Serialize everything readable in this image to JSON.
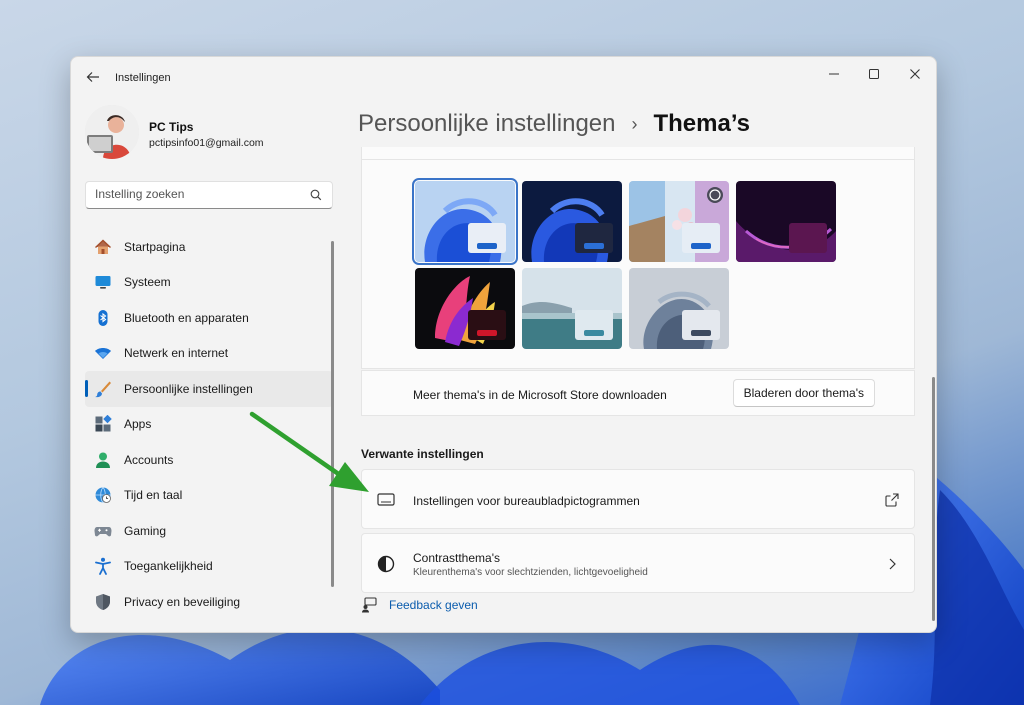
{
  "window": {
    "app_title": "Instellingen",
    "back_icon": "arrow-left-icon",
    "controls": [
      "minimize-icon",
      "maximize-icon",
      "close-icon"
    ]
  },
  "profile": {
    "name": "PC Tips",
    "email": "pctipsinfo01@gmail.com"
  },
  "search": {
    "placeholder": "Instelling zoeken",
    "icon": "search-icon"
  },
  "sidebar": {
    "items": [
      {
        "label": "Startpagina",
        "icon": "home-icon",
        "active": false
      },
      {
        "label": "Systeem",
        "icon": "monitor-icon",
        "active": false
      },
      {
        "label": "Bluetooth en apparaten",
        "icon": "bluetooth-icon",
        "active": false
      },
      {
        "label": "Netwerk en internet",
        "icon": "wifi-icon",
        "active": false
      },
      {
        "label": "Persoonlijke instellingen",
        "icon": "paintbrush-icon",
        "active": true
      },
      {
        "label": "Apps",
        "icon": "apps-icon",
        "active": false
      },
      {
        "label": "Accounts",
        "icon": "person-icon",
        "active": false
      },
      {
        "label": "Tijd en taal",
        "icon": "globe-clock-icon",
        "active": false
      },
      {
        "label": "Gaming",
        "icon": "gamepad-icon",
        "active": false
      },
      {
        "label": "Toegankelijkheid",
        "icon": "accessibility-icon",
        "active": false
      },
      {
        "label": "Privacy en beveiliging",
        "icon": "shield-icon",
        "active": false
      }
    ]
  },
  "header": {
    "parent": "Persoonlijke instellingen",
    "separator": "›",
    "current": "Thema’s"
  },
  "themes": {
    "items": [
      {
        "name": "windows-light",
        "selected": true
      },
      {
        "name": "windows-dark",
        "selected": false
      },
      {
        "name": "spotlight",
        "selected": false
      },
      {
        "name": "glow",
        "selected": false
      },
      {
        "name": "captured-motion",
        "selected": false
      },
      {
        "name": "sunrise",
        "selected": false
      },
      {
        "name": "flow",
        "selected": false
      }
    ],
    "store_text": "Meer thema's in de Microsoft Store downloaden",
    "browse_label": "Bladeren door thema's"
  },
  "related": {
    "title": "Verwante instellingen",
    "items": [
      {
        "title": "Instellingen voor bureaubladpictogrammen",
        "subtitle": "",
        "icon": "desktop-icon",
        "trail_icon": "open-external-icon"
      },
      {
        "title": "Contrastthema's",
        "subtitle": "Kleurenthema's voor slechtzienden, lichtgevoeligheid",
        "icon": "contrast-icon",
        "trail_icon": "chevron-right-icon"
      }
    ]
  },
  "feedback": {
    "label": "Feedback geven",
    "icon": "feedback-icon"
  },
  "colors": {
    "accent": "#005fb8",
    "annotation_arrow": "#2fa02f"
  }
}
